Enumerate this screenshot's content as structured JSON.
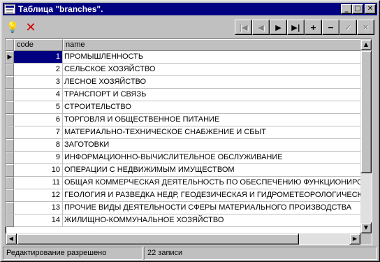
{
  "window": {
    "title": "Таблица \"branches\".",
    "minimize": "_",
    "maximize": "□",
    "close": "✕"
  },
  "toolbar": {
    "left_icons": [
      "lightbulb-icon",
      "delete-icon"
    ],
    "nav": [
      {
        "name": "first",
        "glyph": "|◀",
        "enabled": false
      },
      {
        "name": "prior",
        "glyph": "◀",
        "enabled": false
      },
      {
        "name": "next",
        "glyph": "▶",
        "enabled": true
      },
      {
        "name": "last",
        "glyph": "▶|",
        "enabled": true
      },
      {
        "name": "insert",
        "glyph": "+",
        "enabled": true
      },
      {
        "name": "delete",
        "glyph": "−",
        "enabled": true
      },
      {
        "name": "post",
        "glyph": "✓",
        "enabled": false
      },
      {
        "name": "cancel",
        "glyph": "✕",
        "enabled": false
      }
    ]
  },
  "grid": {
    "columns": [
      "code",
      "name"
    ],
    "selected_row": 0,
    "rows": [
      {
        "code": "1",
        "name": "ПРОМЫШЛЕННОСТЬ"
      },
      {
        "code": "2",
        "name": "СЕЛЬСКОЕ ХОЗЯЙСТВО"
      },
      {
        "code": "3",
        "name": "ЛЕСНОЕ ХОЗЯЙСТВО"
      },
      {
        "code": "4",
        "name": "ТРАНСПОРТ И СВЯЗЬ"
      },
      {
        "code": "5",
        "name": "СТРОИТЕЛЬСТВО"
      },
      {
        "code": "6",
        "name": "ТОРГОВЛЯ И ОБЩЕСТВЕННОЕ ПИТАНИЕ"
      },
      {
        "code": "7",
        "name": "МАТЕРИАЛЬНО-ТЕХНИЧЕСКОЕ СНАБЖЕНИЕ И СБЫТ"
      },
      {
        "code": "8",
        "name": "ЗАГОТОВКИ"
      },
      {
        "code": "9",
        "name": "ИНФОРМАЦИОННО-ВЫЧИСЛИТЕЛЬНОЕ ОБСЛУЖИВАНИЕ"
      },
      {
        "code": "10",
        "name": "ОПЕРАЦИИ С НЕДВИЖИМЫМ ИМУЩЕСТВОМ"
      },
      {
        "code": "11",
        "name": "ОБЩАЯ КОММЕРЧЕСКАЯ ДЕЯТЕЛЬНОСТЬ ПО ОБЕСПЕЧЕНИЮ ФУНКЦИОНИРОВА"
      },
      {
        "code": "12",
        "name": "ГЕОЛОГИЯ И РАЗВЕДКА НЕДР, ГЕОДЕЗИЧЕСКАЯ И ГИДРОМЕТЕОРОЛОГИЧЕСКА"
      },
      {
        "code": "13",
        "name": "ПРОЧИЕ ВИДЫ ДЕЯТЕЛЬНОСТИ СФЕРЫ МАТЕРИАЛЬНОГО ПРОИЗВОДСТВА"
      },
      {
        "code": "14",
        "name": "ЖИЛИЩНО-КОММУНАЛЬНОЕ ХОЗЯЙСТВО"
      }
    ]
  },
  "status": {
    "mode": "Редактирование разрешено",
    "count": "22 записи"
  }
}
